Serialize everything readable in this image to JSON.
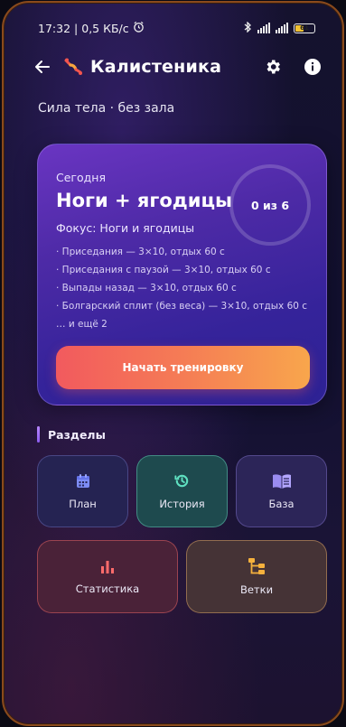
{
  "status_bar": {
    "time": "17:32",
    "net_speed": "0,5 КБ/с",
    "battery": "61"
  },
  "appbar": {
    "title": "Калистеника"
  },
  "subtitle": "Сила тела · без зала",
  "today": {
    "label": "Сегодня",
    "workout_name": "Ноги + ягодицы",
    "progress_text": "0 из 6",
    "progress_fraction": 0,
    "focus": "Фокус: Ноги и ягодицы",
    "exercises": [
      "· Приседания — 3×10, отдых 60 с",
      "· Приседания с паузой — 3×10, отдых 60 с",
      "· Выпады назад — 3×10, отдых 60 с",
      "· Болгарский сплит (без веса) — 3×10, отдых 60 с"
    ],
    "more": "… и ещё 2",
    "start_label": "Начать тренировку"
  },
  "sections": {
    "title": "Разделы",
    "tiles": {
      "plan": "План",
      "history": "История",
      "base": "База",
      "stats": "Статистика",
      "branches": "Ветки"
    }
  },
  "icons": {
    "back": "arrow-left-icon",
    "logo": "muscle-logo-icon",
    "settings": "gear-icon",
    "info": "info-icon",
    "plan": "calendar-icon",
    "history": "history-icon",
    "base": "book-icon",
    "stats": "bar-chart-icon",
    "branches": "tree-icon"
  },
  "colors": {
    "accent": "#8c5cf0",
    "start_gradient_from": "#f25a5e",
    "start_gradient_to": "#f8a64c",
    "history_icon": "#5fe0c0",
    "stats_icon": "#ff6b6b",
    "branches_icon": "#f5b13d"
  }
}
